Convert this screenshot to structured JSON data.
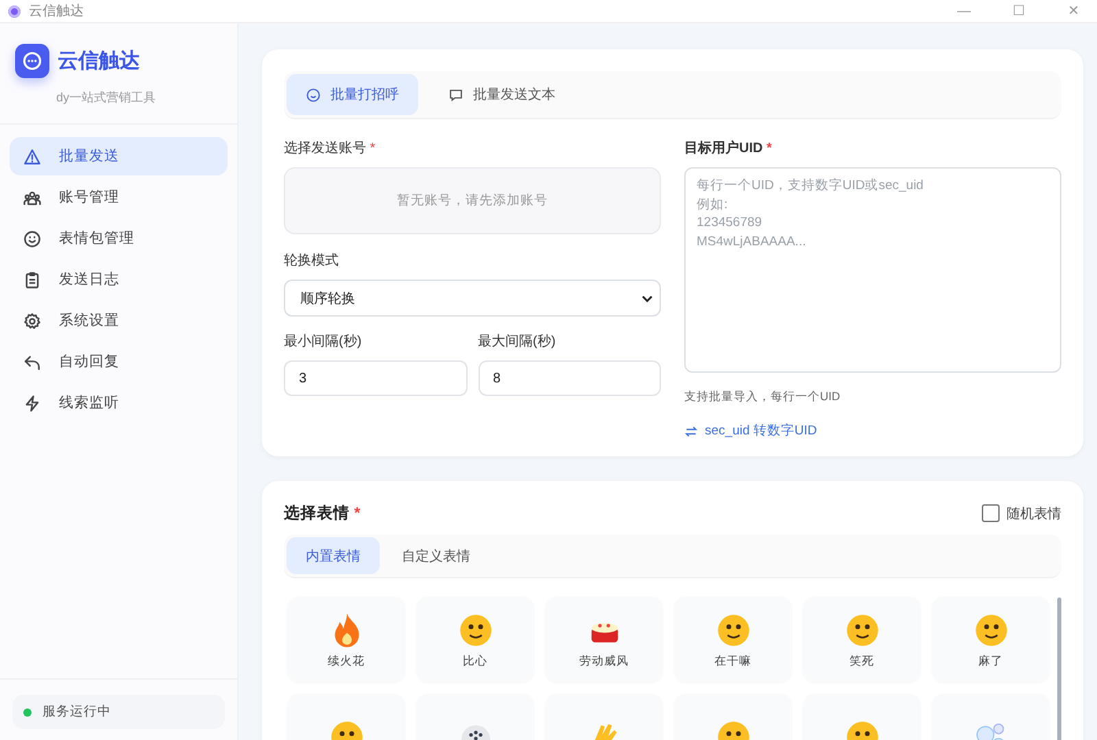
{
  "window": {
    "title": "云信触达",
    "controls": [
      "—",
      "☐",
      "✕"
    ]
  },
  "sidebar": {
    "brand": "云信触达",
    "tagline": "dy一站式营销工具",
    "items": [
      {
        "label": "批量发送",
        "kind": "warning",
        "selected": true
      },
      {
        "label": "账号管理",
        "kind": "users",
        "selected": false
      },
      {
        "label": "表情包管理",
        "kind": "smile",
        "selected": false
      },
      {
        "label": "发送日志",
        "kind": "clipboard",
        "selected": false
      },
      {
        "label": "系统设置",
        "kind": "gear",
        "selected": false
      },
      {
        "label": "自动回复",
        "kind": "reply",
        "selected": false
      },
      {
        "label": "线索监听",
        "kind": "bolt",
        "selected": false
      }
    ],
    "status": {
      "label": "服务运行中",
      "color": "#22c55e"
    }
  },
  "send_card": {
    "tabs": [
      {
        "label": "批量打招呼",
        "kind": "smile",
        "selected": true
      },
      {
        "label": "批量发送文本",
        "kind": "chat",
        "selected": false
      }
    ],
    "account": {
      "label": "选择发送账号",
      "required_mark": "*",
      "empty": "暂无账号，请先添加账号"
    },
    "rotation": {
      "label": "轮换模式",
      "value": "顺序轮换"
    },
    "min_interval": {
      "label": "最小间隔(秒)",
      "value": "3"
    },
    "max_interval": {
      "label": "最大间隔(秒)",
      "value": "8"
    },
    "uid": {
      "label": "目标用户UID",
      "required_mark": "*",
      "placeholder": "每行一个UID，支持数字UID或sec_uid\n例如:\n123456789\nMS4wLjABAAAA...",
      "hint": "支持批量导入，每行一个UID",
      "link": "sec_uid 转数字UID"
    }
  },
  "emoji_card": {
    "title": "选择表情",
    "required_mark": "*",
    "random": {
      "label": "随机表情",
      "checked": false
    },
    "tabs": [
      {
        "label": "内置表情",
        "selected": true
      },
      {
        "label": "自定义表情",
        "selected": false
      }
    ],
    "emojis": [
      {
        "label": "续火花",
        "kind": "flame"
      },
      {
        "label": "比心",
        "kind": "face"
      },
      {
        "label": "劳动威风",
        "kind": "cake"
      },
      {
        "label": "在干嘛",
        "kind": "face"
      },
      {
        "label": "笑死",
        "kind": "face"
      },
      {
        "label": "麻了",
        "kind": "face"
      },
      {
        "kind": "face"
      },
      {
        "kind": "dots"
      },
      {
        "kind": "hand"
      },
      {
        "kind": "face"
      },
      {
        "kind": "face"
      },
      {
        "kind": "bubbles"
      }
    ]
  }
}
